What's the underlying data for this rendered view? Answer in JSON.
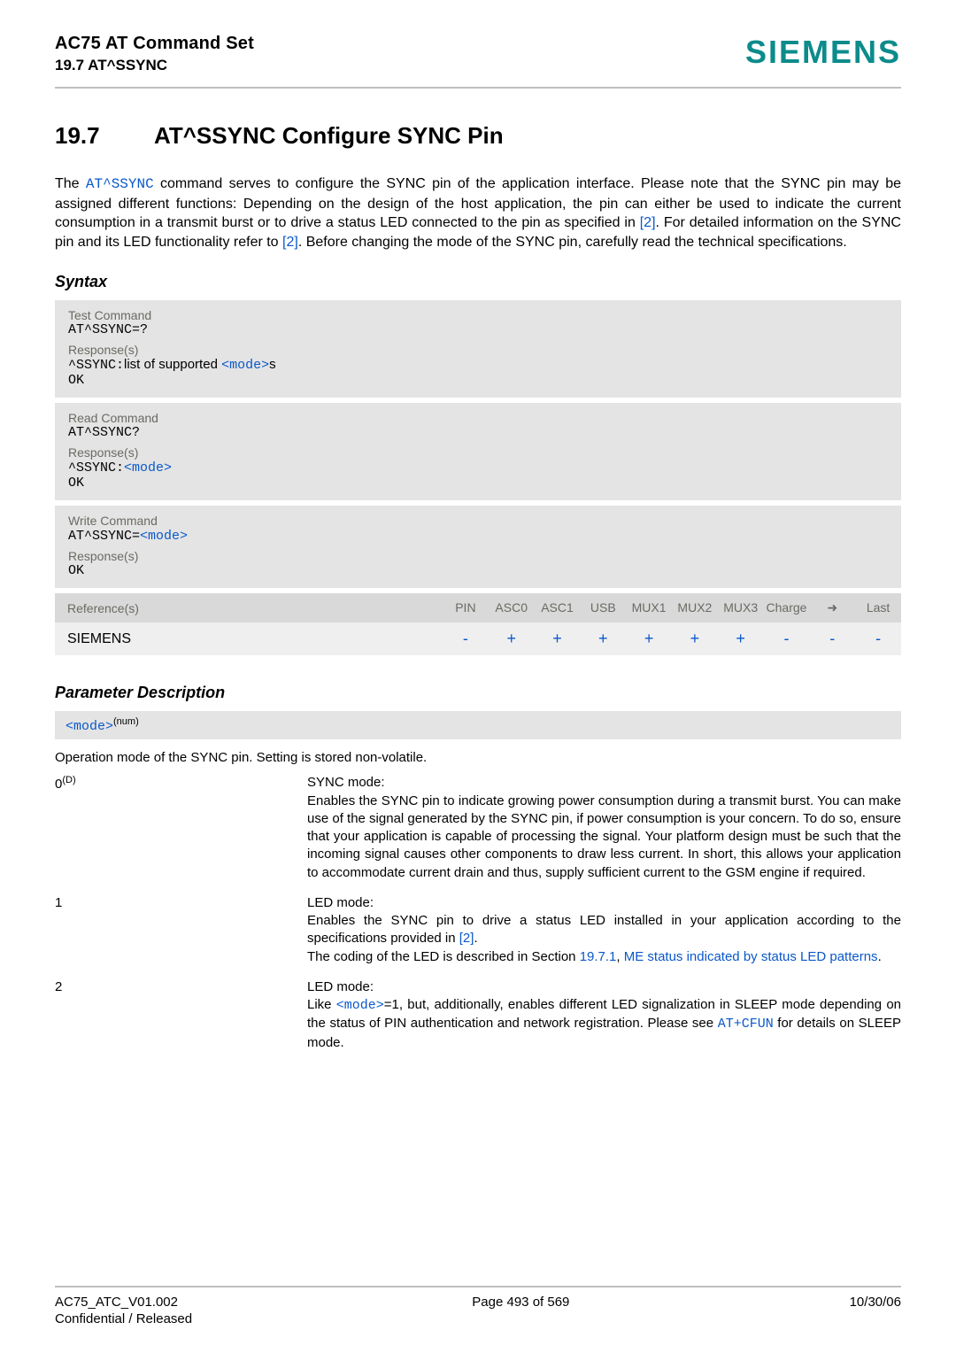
{
  "header": {
    "line1": "AC75 AT Command Set",
    "line2": "19.7 AT^SSYNC",
    "brand": "SIEMENS"
  },
  "section": {
    "number": "19.7",
    "title": "AT^SSYNC   Configure SYNC Pin"
  },
  "intro": {
    "pre": "The ",
    "cmd": "AT^SSYNC",
    "t1": " command serves to configure the SYNC pin of the application interface. Please note that the SYNC pin may be assigned different functions: Depending on the design of the host application, the pin can either be used to indicate the current consumption in a transmit burst or to drive a status LED connected to the pin as specified in ",
    "ref1": "[2]",
    "t2": ". For detailed information on the SYNC pin and its LED functionality refer to ",
    "ref2": "[2]",
    "t3": ". Before changing the mode of the SYNC pin, carefully read the technical specifications."
  },
  "syntax_label": "Syntax",
  "panels": {
    "test": {
      "caption": "Test Command",
      "cmd": "AT^SSYNC=?",
      "resp_caption": "Response(s)",
      "resp_pre": "^SSYNC:",
      "resp_mid": "list of supported ",
      "resp_mode": "<mode>",
      "resp_suf": "s",
      "ok": "OK"
    },
    "read": {
      "caption": "Read Command",
      "cmd": "AT^SSYNC?",
      "resp_caption": "Response(s)",
      "resp_pre": "^SSYNC:",
      "resp_mode": "<mode>",
      "ok": "OK"
    },
    "write": {
      "caption": "Write Command",
      "cmd_pre": "AT^SSYNC=",
      "cmd_mode": "<mode>",
      "resp_caption": "Response(s)",
      "ok": "OK"
    }
  },
  "ref_table": {
    "label": "Reference(s)",
    "cols": [
      "PIN",
      "ASC0",
      "ASC1",
      "USB",
      "MUX1",
      "MUX2",
      "MUX3",
      "Charge",
      "➜",
      "Last"
    ],
    "value_label": "SIEMENS",
    "values": [
      "-",
      "+",
      "+",
      "+",
      "+",
      "+",
      "+",
      "-",
      "-",
      "-"
    ]
  },
  "param_label": "Parameter Description",
  "mode_bar": {
    "name": "<mode>",
    "sup": "(num)"
  },
  "op_mode_line": "Operation mode of the SYNC pin. Setting is stored non-volatile.",
  "rows": [
    {
      "key": "0",
      "key_sup": "(D)",
      "title": "SYNC mode:",
      "body": "Enables the SYNC pin to indicate growing power consumption during a transmit burst. You can make use of the signal generated by the SYNC pin, if power consumption is your concern. To do so, ensure that your application is capable of processing the signal. Your platform design must be such that the incoming signal causes other components to draw less current. In short, this allows your application to accommodate current drain and thus, supply sufficient current to the GSM engine if required."
    },
    {
      "key": "1",
      "title": "LED mode:",
      "body_pre": "Enables the SYNC pin to drive a status LED installed in your application according to the specifications provided in ",
      "ref": "[2]",
      "body_mid": ".\nThe coding of the LED is described in Section ",
      "sect": "19.7.1",
      "comma": ", ",
      "link": "ME status indicated by status LED patterns",
      "dot": "."
    },
    {
      "key": "2",
      "title": "LED mode:",
      "like_pre": "Like ",
      "mode": "<mode>",
      "like_post": "=1, but, additionally, enables different LED signalization in SLEEP mode depending on the status of PIN authentication and network registration. Please see ",
      "cfun": "AT+CFUN",
      "tail": " for details on SLEEP mode."
    }
  ],
  "footer": {
    "l1": "AC75_ATC_V01.002",
    "l2": "Confidential / Released",
    "center": "Page 493 of 569",
    "right": "10/30/06"
  }
}
